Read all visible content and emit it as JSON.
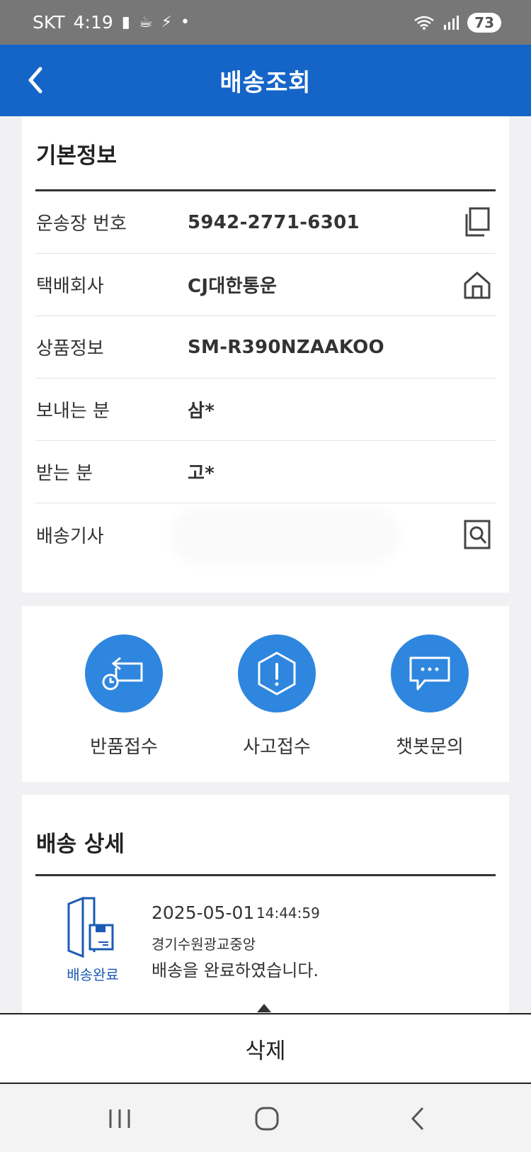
{
  "status_bar": {
    "carrier": "SKT",
    "time": "4:19",
    "battery": "73"
  },
  "header": {
    "title": "배송조회"
  },
  "basic_info": {
    "title": "기본정보",
    "rows": [
      {
        "label": "운송장 번호",
        "value": "5942-2771-6301",
        "icon": "copy-icon"
      },
      {
        "label": "택배회사",
        "value": "CJ대한통운",
        "icon": "home-icon"
      },
      {
        "label": "상품정보",
        "value": "SM-R390NZAAKOO"
      },
      {
        "label": "보내는 분",
        "value": "삼*"
      },
      {
        "label": "받는 분",
        "value": "고*"
      },
      {
        "label": "배송기사",
        "value": "",
        "icon": "search-document-icon"
      }
    ]
  },
  "actions": [
    {
      "label": "반품접수",
      "icon": "return-icon"
    },
    {
      "label": "사고접수",
      "icon": "warning-icon"
    },
    {
      "label": "챗봇문의",
      "icon": "chat-icon"
    }
  ],
  "delivery_detail": {
    "title": "배송 상세",
    "entries": [
      {
        "status": "배송완료",
        "date": "2025-05-01",
        "time": "14:44:59",
        "location": "경기수원광교중앙",
        "message": "배송을 완료하였습니다."
      }
    ]
  },
  "delete_label": "삭제",
  "colors": {
    "brand_blue": "#1565c9",
    "action_blue": "#2e86de",
    "status_blue": "#1b5bb5"
  }
}
